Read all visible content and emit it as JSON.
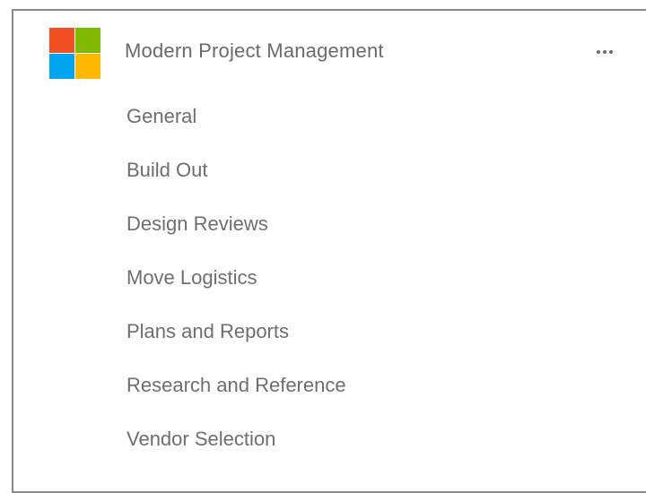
{
  "team": {
    "name": "Modern Project Management",
    "logo_icon": "microsoft-logo-icon",
    "logo_colors": [
      "#f25022",
      "#7fba00",
      "#00a4ef",
      "#ffb900"
    ],
    "more_icon": "more-options-icon"
  },
  "channels": [
    {
      "label": "General"
    },
    {
      "label": "Build Out"
    },
    {
      "label": "Design Reviews"
    },
    {
      "label": "Move Logistics"
    },
    {
      "label": "Plans and Reports"
    },
    {
      "label": "Research and Reference"
    },
    {
      "label": "Vendor Selection"
    }
  ]
}
